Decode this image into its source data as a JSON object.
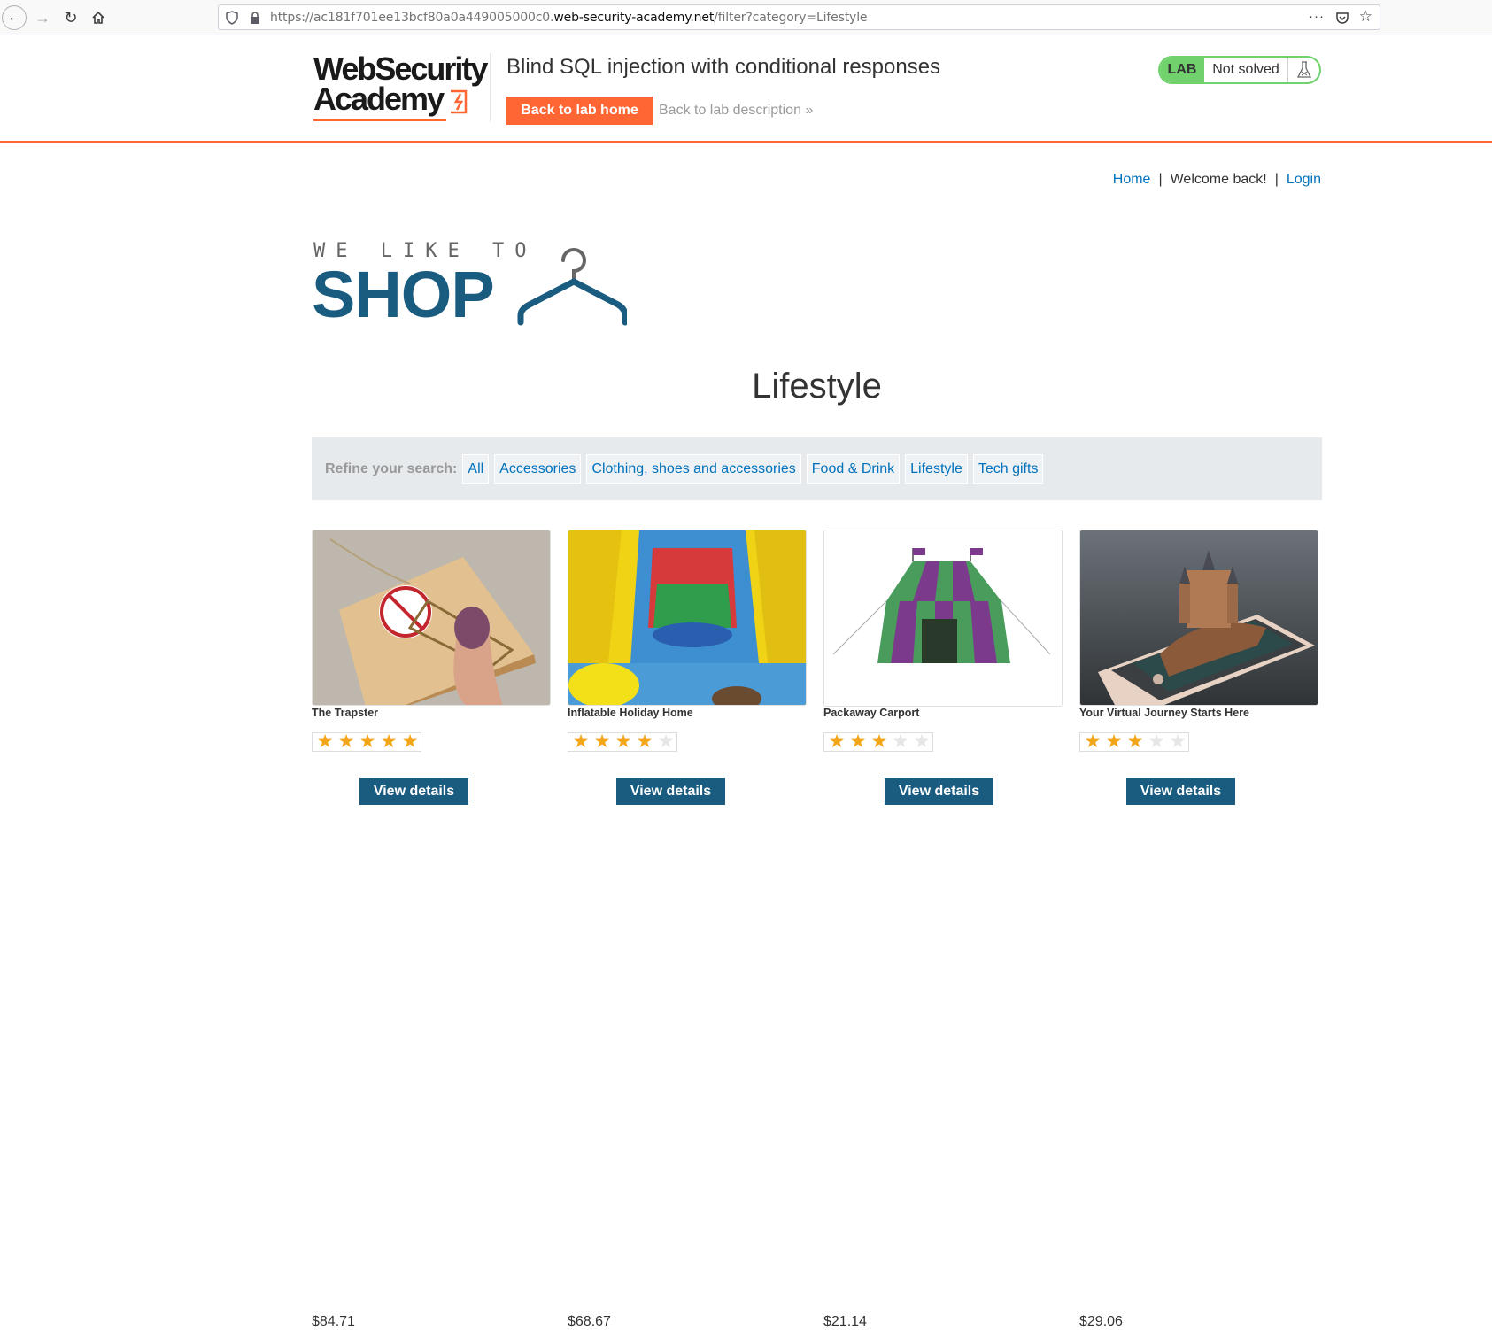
{
  "browser": {
    "url_prefix": "https://ac181f701ee13bcf80a0a449005000c0.",
    "url_domain": "web-security-academy.net",
    "url_path": "/filter?category=Lifestyle",
    "more_icon": "···"
  },
  "lab": {
    "logo_line1": "WebSecurity",
    "logo_line2": "Academy",
    "title": "Blind SQL injection with conditional responses",
    "back_home": "Back to lab home",
    "back_desc": "Back to lab description",
    "desc_arrow": "»",
    "badge": "LAB",
    "status": "Not solved",
    "brand_color": "#ff6633",
    "solved_color": "#70d16d"
  },
  "nav": {
    "home": "Home",
    "sep1": "|",
    "welcome": "Welcome back!",
    "sep2": "|",
    "login": "Login"
  },
  "shop_logo": {
    "tagline": "WE LIKE TO",
    "word": "SHOP",
    "color": "#1a5b80"
  },
  "page": {
    "title": "Lifestyle"
  },
  "filter": {
    "label": "Refine your search:",
    "categories": [
      "All",
      "Accessories",
      "Clothing, shoes and accessories",
      "Food & Drink",
      "Lifestyle",
      "Tech gifts"
    ]
  },
  "products": [
    {
      "name": "The Trapster",
      "rating": 5,
      "price": "$84.71",
      "button": "View details",
      "image": "mousetrap-icon"
    },
    {
      "name": "Inflatable Holiday Home",
      "rating": 4,
      "price": "$68.67",
      "button": "View details",
      "image": "bouncy-castle-icon"
    },
    {
      "name": "Packaway Carport",
      "rating": 3,
      "price": "$21.14",
      "button": "View details",
      "image": "tent-icon"
    },
    {
      "name": "Your Virtual Journey Starts Here",
      "rating": 3,
      "price": "$29.06",
      "button": "View details",
      "image": "phone-castle-icon"
    }
  ]
}
